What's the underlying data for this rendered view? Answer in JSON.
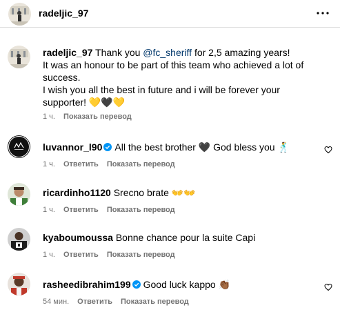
{
  "header": {
    "username": "radeljic_97"
  },
  "caption": {
    "username": "radeljic_97",
    "text_before_mention": " Thank you ",
    "mention": "@fc_sheriff",
    "text_after_mention": " for 2,5 amazing years!",
    "line2": "It was an honour to be part of this team who achieved a lot of success.",
    "line3": "I wish you all the best in future and i will be forever your supporter! 💛🖤💛",
    "time": "1 ч.",
    "translate": "Показать перевод"
  },
  "comments": [
    {
      "username": "luvannor_l90",
      "verified": true,
      "text": "All the best brother 🖤 God bless you 🕺",
      "time": "1 ч.",
      "reply": "Ответить",
      "translate": "Показать перевод"
    },
    {
      "username": "ricardinho1120",
      "verified": false,
      "text": "Srecno brate 👐👐",
      "time": "1 ч.",
      "reply": "Ответить",
      "translate": "Показать перевод"
    },
    {
      "username": "kyaboumoussa",
      "verified": false,
      "text": "Bonne chance pour la suite Capi",
      "time": "1 ч.",
      "reply": "Ответить",
      "translate": "Показать перевод"
    },
    {
      "username": "rasheedibrahim199",
      "verified": true,
      "text": "Good luck kappo 👏🏾",
      "time": "54 мин.",
      "reply": "Ответить",
      "translate": "Показать перевод"
    }
  ],
  "colors": {
    "mention": "#00376b",
    "meta": "#737373",
    "verified": "#0095f6"
  }
}
